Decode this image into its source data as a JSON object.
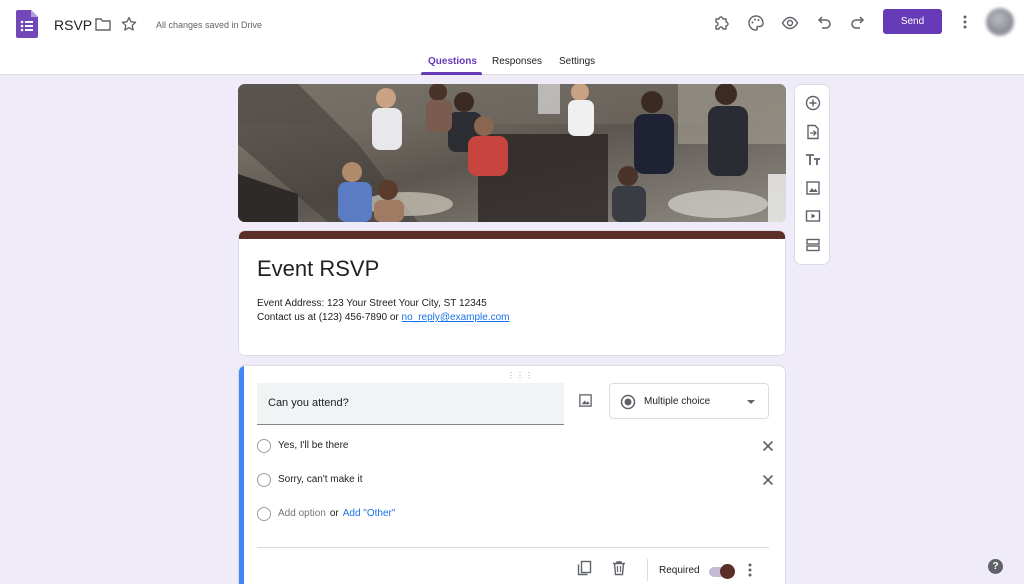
{
  "header": {
    "doc_title": "RSVP",
    "save_status": "All changes saved in Drive",
    "send_label": "Send",
    "accent_color": "#673ab7"
  },
  "icons": {
    "app": "forms-logo-icon",
    "folder": "folder-icon",
    "star": "star-icon",
    "addons": "puzzle-icon",
    "theme": "palette-icon",
    "preview": "eye-icon",
    "undo": "undo-icon",
    "redo": "redo-icon",
    "more": "more-vert-icon"
  },
  "tabs": [
    {
      "label": "Questions",
      "active": true
    },
    {
      "label": "Responses",
      "active": false
    },
    {
      "label": "Settings",
      "active": false
    }
  ],
  "form": {
    "title": "Event RSVP",
    "address_line": "Event Address: 123 Your Street Your City, ST 12345",
    "contact_prefix": "Contact us at (123) 456-7890 or ",
    "contact_email": "no_reply@example.com",
    "theme_color": "#5b2e2a"
  },
  "side_toolbar": [
    "add-question-icon",
    "import-questions-icon",
    "add-title-icon",
    "add-image-icon",
    "add-video-icon",
    "add-section-icon"
  ],
  "question": {
    "text": "Can you attend?",
    "type": "Multiple choice",
    "options": [
      "Yes,  I'll be there",
      "Sorry, can't make it"
    ],
    "add_option": "Add option",
    "or": "or",
    "add_other": "Add \"Other\"",
    "required_label": "Required",
    "required": true
  },
  "help": "?"
}
